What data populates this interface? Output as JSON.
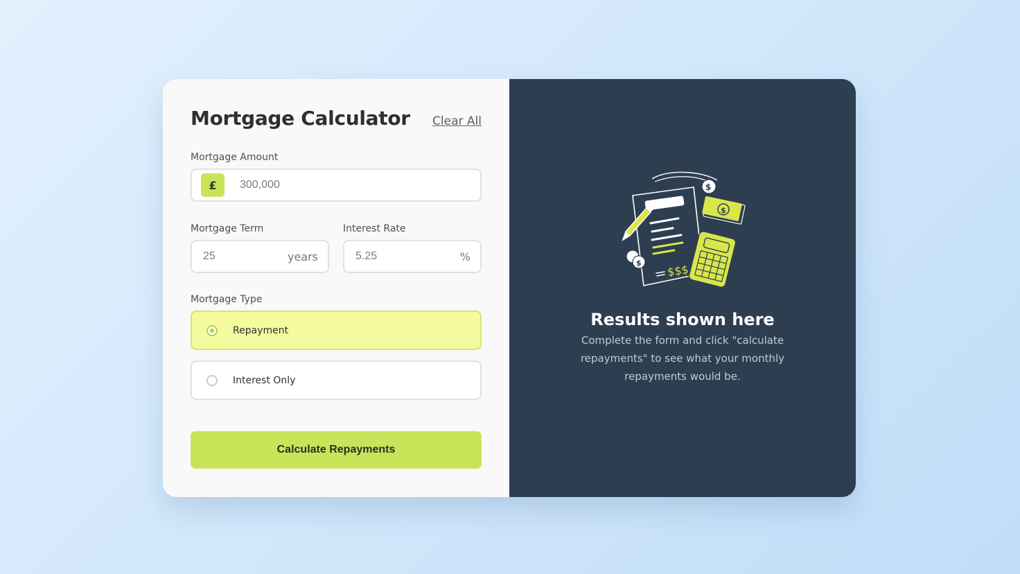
{
  "calculator": {
    "title": "Mortgage Calculator",
    "clear_label": "Clear All",
    "amount": {
      "label": "Mortgage Amount",
      "prefix": "£",
      "value": "300,000"
    },
    "term": {
      "label": "Mortgage Term",
      "value": "25",
      "suffix": "years"
    },
    "rate": {
      "label": "Interest Rate",
      "value": "5.25",
      "suffix": "%"
    },
    "type": {
      "label": "Mortgage Type",
      "options": [
        {
          "label": "Repayment",
          "selected": true
        },
        {
          "label": "Interest Only",
          "selected": false
        }
      ]
    },
    "submit_label": "Calculate Repayments"
  },
  "results": {
    "title": "Results shown here",
    "description": "Complete the form and click \"calculate repayments\" to see what your monthly repayments would be."
  },
  "illustration": {
    "name": "calculator-document-icon",
    "symbols": "$$$"
  },
  "colors": {
    "accent": "#cae45a",
    "selected_bg": "#f4fb9e",
    "panel_dark": "#2d3e50",
    "panel_light": "#f9f9f9"
  }
}
